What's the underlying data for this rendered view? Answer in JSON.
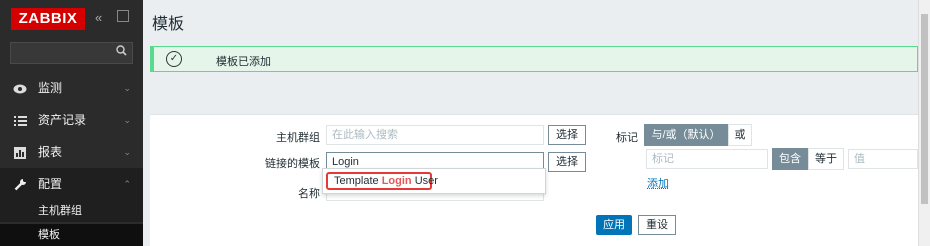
{
  "sidebar": {
    "logo": "ZABBIX",
    "collapse_glyph": "«",
    "menu": [
      {
        "label": "监测",
        "icon": "eye-icon"
      },
      {
        "label": "资产记录",
        "icon": "list-icon"
      },
      {
        "label": "报表",
        "icon": "chart-icon"
      },
      {
        "label": "配置",
        "icon": "wrench-icon"
      }
    ],
    "sub_items": [
      {
        "label": "主机群组"
      },
      {
        "label": "模板"
      }
    ]
  },
  "page": {
    "title": "模板"
  },
  "message": {
    "text": "模板已添加"
  },
  "filter": {
    "host_group_label": "主机群组",
    "host_group_placeholder": "在此输入搜索",
    "select_label": "选择",
    "linked_templates_label": "链接的模板",
    "linked_templates_value": "Login",
    "select2_label": "选择",
    "name_label": "名称",
    "tags_label": "标记",
    "and_or_label": "与/或（默认）",
    "or_label": "或",
    "tag_placeholder": "标记",
    "contains_label": "包含",
    "equals_label": "等于",
    "value_placeholder": "值",
    "add_label": "添加",
    "apply_label": "应用",
    "reset_label": "重设"
  },
  "dropdown": {
    "before": "Template ",
    "match": "Login",
    "after": " User"
  }
}
